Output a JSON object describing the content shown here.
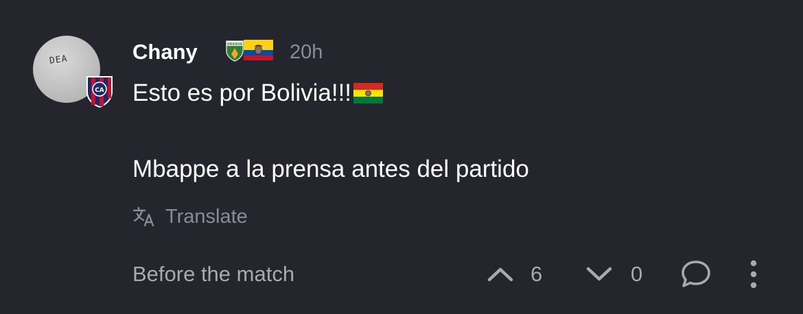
{
  "comment": {
    "author": "Chany",
    "time": "20h",
    "text_line_1": "Esto es por Bolivia!!!",
    "text_line_2": "Mbappe a la prensa antes del partido",
    "avatar_text": "DEA",
    "flair_team_text": "ORENSE",
    "translate_label": "Translate",
    "category": "Before the match",
    "upvotes": "6",
    "downvotes": "0"
  },
  "icons": {
    "upvote": "chevron-up-icon",
    "downvote": "chevron-down-icon",
    "reply": "speech-bubble-icon",
    "more": "vertical-dots-icon",
    "translate": "translate-icon"
  },
  "colors": {
    "background": "#24252d",
    "muted_text": "#8a8b94",
    "secondary_text": "#a8a9b1"
  }
}
